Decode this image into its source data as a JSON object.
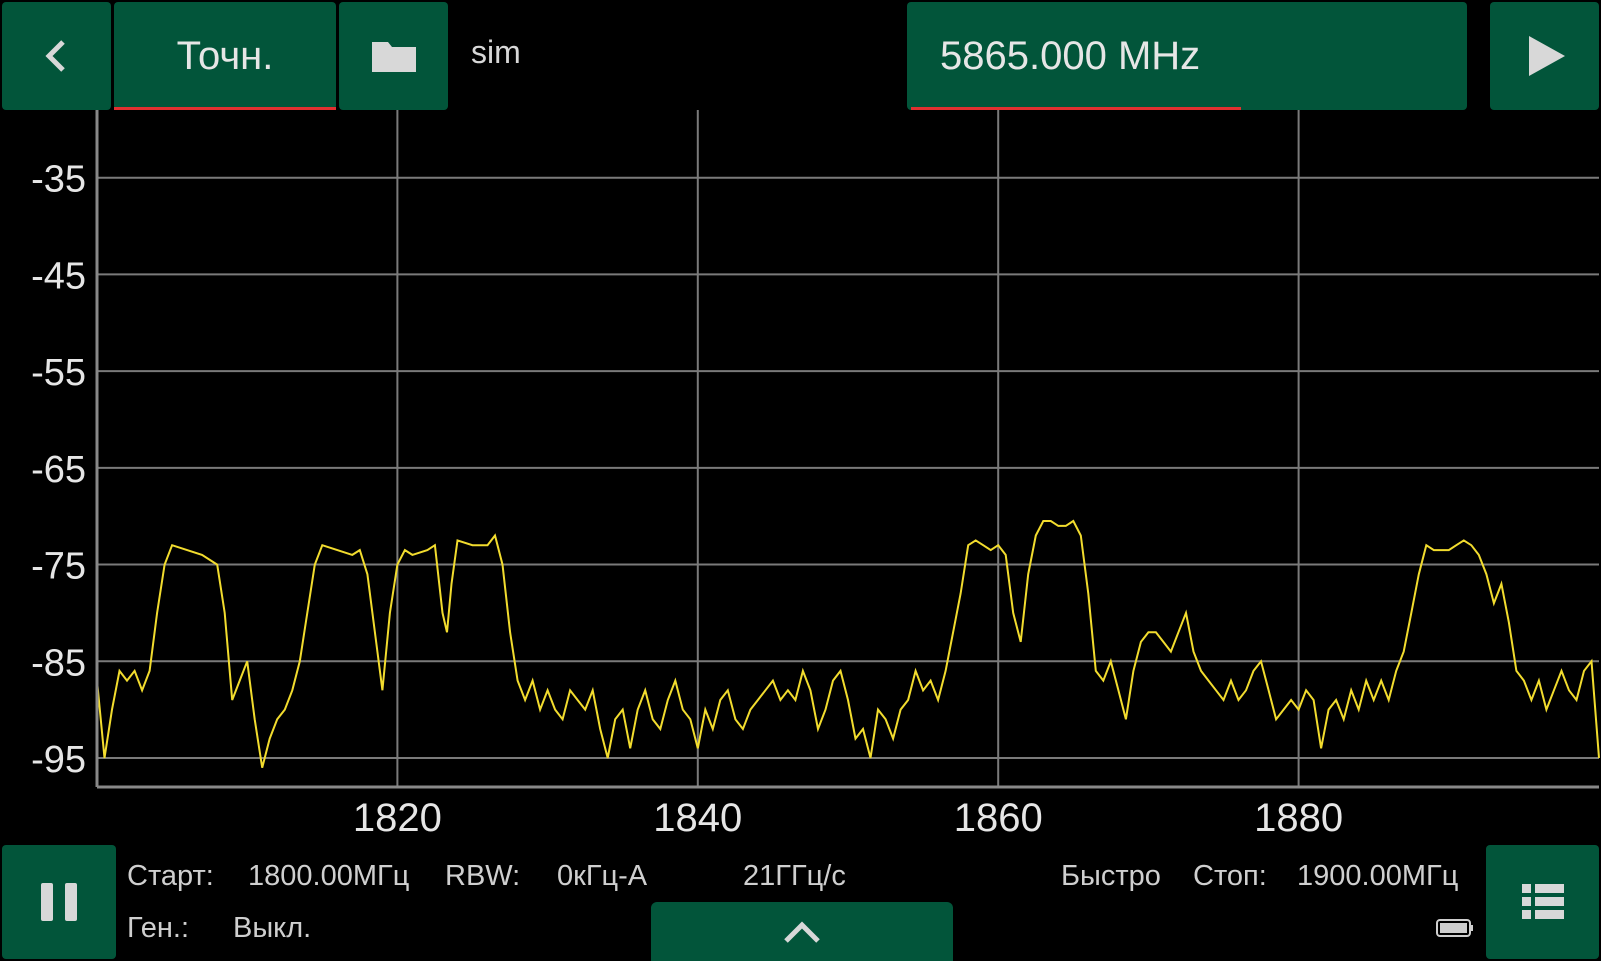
{
  "header": {
    "mode_label": "Точн.",
    "device_label": "sim",
    "frequency_value": "5865.000 MHz"
  },
  "icons": {
    "back": "chevron-left-icon",
    "folder": "folder-icon",
    "play": "play-icon",
    "pause": "pause-icon",
    "expand": "chevron-up-icon",
    "menu": "list-menu-icon",
    "battery": "battery-icon"
  },
  "colors": {
    "button_bg": "#02553a",
    "accent_underline": "#e23030",
    "trace": "#f2dc2e",
    "grid": "#7a7a7a",
    "background": "#000000"
  },
  "status": {
    "start_label": "Старт:",
    "start_value": "1800.00МГц",
    "rbw_label": "RBW:",
    "rbw_value": "0кГц-А",
    "sweep_rate": "21ГГц/с",
    "speed_mode": "Быстро",
    "stop_label": "Стоп:",
    "stop_value": "1900.00МГц",
    "gen_label": "Ген.:",
    "gen_value": "Выкл."
  },
  "chart_data": {
    "type": "line",
    "title": "",
    "xlabel": "",
    "ylabel": "",
    "xlim": [
      1800,
      1900
    ],
    "ylim": [
      -98,
      -28
    ],
    "x_ticks": [
      1820,
      1840,
      1860,
      1880
    ],
    "y_ticks": [
      -35,
      -45,
      -55,
      -65,
      -75,
      -85,
      -95
    ],
    "grid": true,
    "series": [
      {
        "points": [
          [
            1800,
            -87
          ],
          [
            1800.5,
            -95
          ],
          [
            1801,
            -90
          ],
          [
            1801.5,
            -86
          ],
          [
            1802,
            -87
          ],
          [
            1802.5,
            -86
          ],
          [
            1803,
            -88
          ],
          [
            1803.5,
            -86
          ],
          [
            1804,
            -80
          ],
          [
            1804.5,
            -75
          ],
          [
            1805,
            -73
          ],
          [
            1806,
            -73.5
          ],
          [
            1807,
            -74
          ],
          [
            1808,
            -75
          ],
          [
            1808.5,
            -80
          ],
          [
            1809,
            -89
          ],
          [
            1809.5,
            -87
          ],
          [
            1810,
            -85
          ],
          [
            1810.5,
            -91
          ],
          [
            1811,
            -96
          ],
          [
            1811.5,
            -93
          ],
          [
            1812,
            -91
          ],
          [
            1812.5,
            -90
          ],
          [
            1813,
            -88
          ],
          [
            1813.5,
            -85
          ],
          [
            1814,
            -80
          ],
          [
            1814.5,
            -75
          ],
          [
            1815,
            -73
          ],
          [
            1816,
            -73.5
          ],
          [
            1817,
            -74
          ],
          [
            1817.5,
            -73.5
          ],
          [
            1818,
            -76
          ],
          [
            1818.5,
            -82
          ],
          [
            1819,
            -88
          ],
          [
            1819.5,
            -80
          ],
          [
            1820,
            -75
          ],
          [
            1820.5,
            -73.5
          ],
          [
            1821,
            -74
          ],
          [
            1822,
            -73.5
          ],
          [
            1822.5,
            -73
          ],
          [
            1823,
            -80
          ],
          [
            1823.3,
            -82
          ],
          [
            1823.6,
            -77
          ],
          [
            1824,
            -72.5
          ],
          [
            1825,
            -73
          ],
          [
            1826,
            -73
          ],
          [
            1826.5,
            -72
          ],
          [
            1827,
            -75
          ],
          [
            1827.5,
            -82
          ],
          [
            1828,
            -87
          ],
          [
            1828.5,
            -89
          ],
          [
            1829,
            -87
          ],
          [
            1829.5,
            -90
          ],
          [
            1830,
            -88
          ],
          [
            1830.5,
            -90
          ],
          [
            1831,
            -91
          ],
          [
            1831.5,
            -88
          ],
          [
            1832,
            -89
          ],
          [
            1832.5,
            -90
          ],
          [
            1833,
            -88
          ],
          [
            1833.5,
            -92
          ],
          [
            1834,
            -95
          ],
          [
            1834.5,
            -91
          ],
          [
            1835,
            -90
          ],
          [
            1835.5,
            -94
          ],
          [
            1836,
            -90
          ],
          [
            1836.5,
            -88
          ],
          [
            1837,
            -91
          ],
          [
            1837.5,
            -92
          ],
          [
            1838,
            -89
          ],
          [
            1838.5,
            -87
          ],
          [
            1839,
            -90
          ],
          [
            1839.5,
            -91
          ],
          [
            1840,
            -94
          ],
          [
            1840.5,
            -90
          ],
          [
            1841,
            -92
          ],
          [
            1841.5,
            -89
          ],
          [
            1842,
            -88
          ],
          [
            1842.5,
            -91
          ],
          [
            1843,
            -92
          ],
          [
            1843.5,
            -90
          ],
          [
            1844,
            -89
          ],
          [
            1844.5,
            -88
          ],
          [
            1845,
            -87
          ],
          [
            1845.5,
            -89
          ],
          [
            1846,
            -88
          ],
          [
            1846.5,
            -89
          ],
          [
            1847,
            -86
          ],
          [
            1847.5,
            -88
          ],
          [
            1848,
            -92
          ],
          [
            1848.5,
            -90
          ],
          [
            1849,
            -87
          ],
          [
            1849.5,
            -86
          ],
          [
            1850,
            -89
          ],
          [
            1850.5,
            -93
          ],
          [
            1851,
            -92
          ],
          [
            1851.5,
            -95
          ],
          [
            1852,
            -90
          ],
          [
            1852.5,
            -91
          ],
          [
            1853,
            -93
          ],
          [
            1853.5,
            -90
          ],
          [
            1854,
            -89
          ],
          [
            1854.5,
            -86
          ],
          [
            1855,
            -88
          ],
          [
            1855.5,
            -87
          ],
          [
            1856,
            -89
          ],
          [
            1856.5,
            -86
          ],
          [
            1857,
            -82
          ],
          [
            1857.5,
            -78
          ],
          [
            1858,
            -73
          ],
          [
            1858.5,
            -72.5
          ],
          [
            1859,
            -73
          ],
          [
            1859.5,
            -73.5
          ],
          [
            1860,
            -73
          ],
          [
            1860.5,
            -74
          ],
          [
            1861,
            -80
          ],
          [
            1861.5,
            -83
          ],
          [
            1862,
            -76
          ],
          [
            1862.5,
            -72
          ],
          [
            1863,
            -70.5
          ],
          [
            1863.5,
            -70.5
          ],
          [
            1864,
            -71
          ],
          [
            1864.5,
            -71
          ],
          [
            1865,
            -70.5
          ],
          [
            1865.5,
            -72
          ],
          [
            1866,
            -78
          ],
          [
            1866.5,
            -86
          ],
          [
            1867,
            -87
          ],
          [
            1867.5,
            -85
          ],
          [
            1868,
            -88
          ],
          [
            1868.5,
            -91
          ],
          [
            1869,
            -86
          ],
          [
            1869.5,
            -83
          ],
          [
            1870,
            -82
          ],
          [
            1870.5,
            -82
          ],
          [
            1871,
            -83
          ],
          [
            1871.5,
            -84
          ],
          [
            1872,
            -82
          ],
          [
            1872.5,
            -80
          ],
          [
            1873,
            -84
          ],
          [
            1873.5,
            -86
          ],
          [
            1874,
            -87
          ],
          [
            1874.5,
            -88
          ],
          [
            1875,
            -89
          ],
          [
            1875.5,
            -87
          ],
          [
            1876,
            -89
          ],
          [
            1876.5,
            -88
          ],
          [
            1877,
            -86
          ],
          [
            1877.5,
            -85
          ],
          [
            1878,
            -88
          ],
          [
            1878.5,
            -91
          ],
          [
            1879,
            -90
          ],
          [
            1879.5,
            -89
          ],
          [
            1880,
            -90
          ],
          [
            1880.5,
            -88
          ],
          [
            1881,
            -89
          ],
          [
            1881.5,
            -94
          ],
          [
            1882,
            -90
          ],
          [
            1882.5,
            -89
          ],
          [
            1883,
            -91
          ],
          [
            1883.5,
            -88
          ],
          [
            1884,
            -90
          ],
          [
            1884.5,
            -87
          ],
          [
            1885,
            -89
          ],
          [
            1885.5,
            -87
          ],
          [
            1886,
            -89
          ],
          [
            1886.5,
            -86
          ],
          [
            1887,
            -84
          ],
          [
            1887.5,
            -80
          ],
          [
            1888,
            -76
          ],
          [
            1888.5,
            -73
          ],
          [
            1889,
            -73.5
          ],
          [
            1890,
            -73.5
          ],
          [
            1890.5,
            -73
          ],
          [
            1891,
            -72.5
          ],
          [
            1891.5,
            -73
          ],
          [
            1892,
            -74
          ],
          [
            1892.5,
            -76
          ],
          [
            1893,
            -79
          ],
          [
            1893.5,
            -77
          ],
          [
            1894,
            -81
          ],
          [
            1894.5,
            -86
          ],
          [
            1895,
            -87
          ],
          [
            1895.5,
            -89
          ],
          [
            1896,
            -87
          ],
          [
            1896.5,
            -90
          ],
          [
            1897,
            -88
          ],
          [
            1897.5,
            -86
          ],
          [
            1898,
            -88
          ],
          [
            1898.5,
            -89
          ],
          [
            1899,
            -86
          ],
          [
            1899.5,
            -85
          ],
          [
            1900,
            -95
          ]
        ]
      }
    ]
  }
}
